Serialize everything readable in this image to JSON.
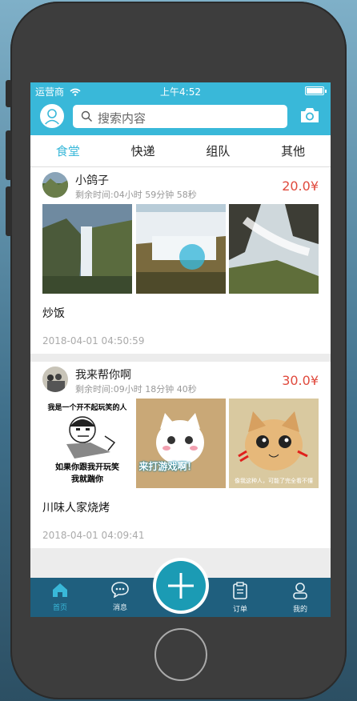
{
  "status": {
    "carrier": "运营商",
    "time": "上午4:52"
  },
  "header": {
    "search_placeholder": "搜索内容",
    "avatar_icon": "user-avatar-icon",
    "camera_icon": "camera-icon"
  },
  "tabs": [
    {
      "label": "食堂",
      "active": true
    },
    {
      "label": "快递",
      "active": false
    },
    {
      "label": "组队",
      "active": false
    },
    {
      "label": "其他",
      "active": false
    }
  ],
  "posts": [
    {
      "user": "小鸽子",
      "remaining": "剩余时间:04小时 59分钟 58秒",
      "price": "20.0¥",
      "title": "炒饭",
      "date": "2018-04-01 04:50:59"
    },
    {
      "user": "我来帮你啊",
      "remaining": "剩余时间:09小时 18分钟 40秒",
      "price": "30.0¥",
      "title": "川味人家烧烤",
      "date": "2018-04-01 04:09:41"
    }
  ],
  "meme": {
    "top": "我是一个开不起玩笑的人",
    "bottom1": "如果你跟我开玩笑",
    "bottom2": "我就踹你",
    "cat1": "来打游戏啊！",
    "cat2": "像我这种人，可能了完全看不懂"
  },
  "tabbar": [
    {
      "label": "首页",
      "icon": "home-icon",
      "active": true
    },
    {
      "label": "消息",
      "icon": "chat-icon",
      "active": false
    },
    {
      "label": "订单",
      "icon": "order-icon",
      "active": false
    },
    {
      "label": "我的",
      "icon": "profile-icon",
      "active": false
    }
  ],
  "colors": {
    "accent": "#39b8d9",
    "price": "#e04a3d",
    "tabbar": "#1f5f7e"
  }
}
